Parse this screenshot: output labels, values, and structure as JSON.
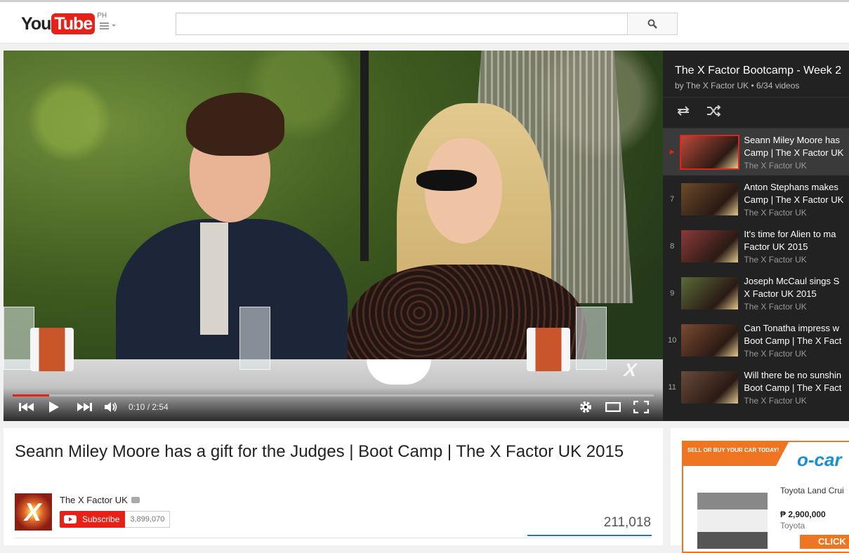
{
  "header": {
    "logo_you": "You",
    "logo_tube": "Tube",
    "country_code": "PH",
    "search_placeholder": ""
  },
  "player": {
    "time": "0:10 / 2:54",
    "progress_fraction": 0.0575,
    "watermark": "X"
  },
  "playlist": {
    "title": "The X Factor Bootcamp - Week 2",
    "meta": "by The X Factor UK • 6/34 videos",
    "items": [
      {
        "index": "▶",
        "line1": "Seann Miley Moore has",
        "line2": "Camp | The X Factor UK",
        "owner": "The X Factor UK",
        "active": true,
        "thumb_color": "#b84a3a"
      },
      {
        "index": "7",
        "line1": "Anton Stephans makes",
        "line2": "Camp | The X Factor UK",
        "owner": "The X Factor UK",
        "active": false,
        "thumb_color": "#6b4a2a"
      },
      {
        "index": "8",
        "line1": "It's time for Alien to ma",
        "line2": "Factor UK 2015",
        "owner": "The X Factor UK",
        "active": false,
        "thumb_color": "#8a3a3a"
      },
      {
        "index": "9",
        "line1": "Joseph McCaul sings S",
        "line2": "X Factor UK 2015",
        "owner": "The X Factor UK",
        "active": false,
        "thumb_color": "#5a6a3a"
      },
      {
        "index": "10",
        "line1": "Can Tonatha impress w",
        "line2": "Boot Camp | The X Fact",
        "owner": "The X Factor UK",
        "active": false,
        "thumb_color": "#7a4a32"
      },
      {
        "index": "11",
        "line1": "Will there be no sunshin",
        "line2": "Boot Camp | The X Fact",
        "owner": "The X Factor UK",
        "active": false,
        "thumb_color": "#6a4a3a"
      }
    ]
  },
  "video": {
    "title": "Seann Miley Moore has a gift for the Judges | Boot Camp | The X Factor UK 2015",
    "channel": "The X Factor UK",
    "subscribe_label": "Subscribe",
    "subscriber_count": "3,899,070",
    "views": "211,018"
  },
  "ad": {
    "banner": "SELL OR BUY YOUR CAR TODAY!",
    "logo": "o-car",
    "car_name": "Toyota Land Crui",
    "price": "₱ 2,900,000",
    "brand": "Toyota",
    "cta": "CLICK"
  },
  "colors": {
    "brand_red": "#e62117",
    "link_blue": "#167ac6",
    "ad_orange": "#f07523"
  }
}
